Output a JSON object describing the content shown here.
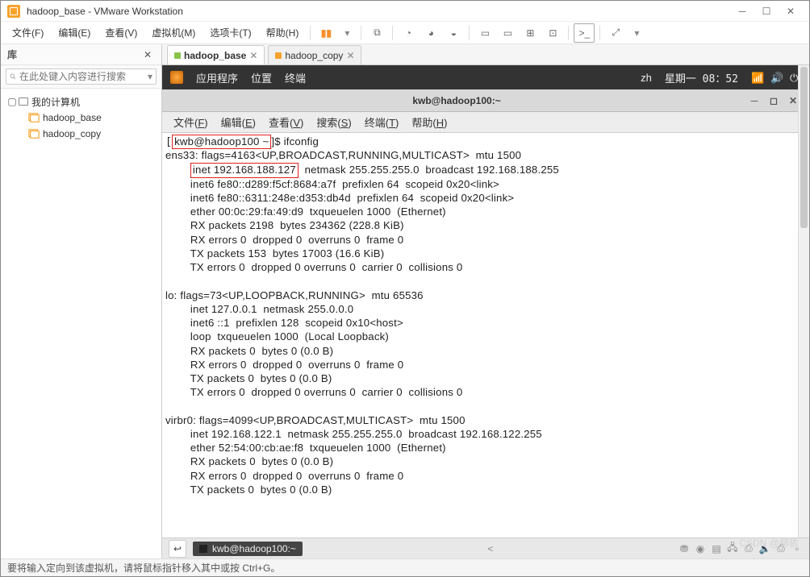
{
  "titlebar": {
    "title": "hadoop_base - VMware Workstation"
  },
  "menubar": {
    "file": "文件(F)",
    "edit": "编辑(E)",
    "view": "查看(V)",
    "vm": "虚拟机(M)",
    "tabs": "选项卡(T)",
    "help": "帮助(H)"
  },
  "sidebar": {
    "title": "库",
    "search_placeholder": "在此处键入内容进行搜索",
    "root": "我的计算机",
    "items": [
      "hadoop_base",
      "hadoop_copy"
    ]
  },
  "tabs": {
    "t1": "hadoop_base",
    "t2": "hadoop_copy"
  },
  "vmtop": {
    "apps": "应用程序",
    "places": "位置",
    "terminal": "终端",
    "lang": "zh",
    "clock": "星期一  08：52"
  },
  "vmwin": {
    "title": "kwb@hadoop100:~"
  },
  "vmmenu": {
    "file": "文件(F)",
    "edit": "编辑(E)",
    "view": "查看(V)",
    "search": "搜索(S)",
    "terminal": "终端(T)",
    "help": "帮助(H)"
  },
  "term": {
    "prompt_user": "kwb@hadoop100 ~",
    "prompt_tail": "]$ ifconfig",
    "l2a": "ens33: flags=4163",
    "l2b": "<UP,BROADCAST,RUNNING,MULTICAST>  mtu 1500",
    "l3a": "        ",
    "l3box": "inet 192.168.188.127",
    "l3b": "  netmask 255.255.255.0  broadcast 192.168.188.255",
    "l4": "        inet6 fe80::d289:f5cf:8684:a7f  prefixlen 64  scopeid 0x20<link>",
    "l5": "        inet6 fe80::6311:248e:d353:db4d  prefixlen 64  scopeid 0x20<link>",
    "l6": "        ether 00:0c:29:fa:49:d9  txqueuelen 1000  (Ethernet)",
    "l7": "        RX packets 2198  bytes 234362 (228.8 KiB)",
    "l8": "        RX errors 0  dropped 0  overruns 0  frame 0",
    "l9": "        TX packets 153  bytes 17003 (16.6 KiB)",
    "l10": "        TX errors 0  dropped 0 overruns 0  carrier 0  collisions 0",
    "blank": "",
    "l12": "lo: flags=73<UP,LOOPBACK,RUNNING>  mtu 65536",
    "l13": "        inet 127.0.0.1  netmask 255.0.0.0",
    "l14": "        inet6 ::1  prefixlen 128  scopeid 0x10<host>",
    "l15": "        loop  txqueuelen 1000  (Local Loopback)",
    "l16": "        RX packets 0  bytes 0 (0.0 B)",
    "l17": "        RX errors 0  dropped 0  overruns 0  frame 0",
    "l18": "        TX packets 0  bytes 0 (0.0 B)",
    "l19": "        TX errors 0  dropped 0 overruns 0  carrier 0  collisions 0",
    "l21": "virbr0: flags=4099<UP,BROADCAST,MULTICAST>  mtu 1500",
    "l22": "        inet 192.168.122.1  netmask 255.255.255.0  broadcast 192.168.122.255",
    "l23": "        ether 52:54:00:cb:ae:f8  txqueuelen 1000  (Ethernet)",
    "l24": "        RX packets 0  bytes 0 (0.0 B)",
    "l25": "        RX errors 0  dropped 0  overruns 0  frame 0",
    "l26": "        TX packets 0  bytes 0 (0.0 B)"
  },
  "vm_status": {
    "breadcrumb": "kwb@hadoop100:~"
  },
  "statusbar": {
    "text": "要将输入定向到该虚拟机，请将鼠标指针移入其中或按 Ctrl+G。"
  },
  "watermark": "CSDN @柳依"
}
